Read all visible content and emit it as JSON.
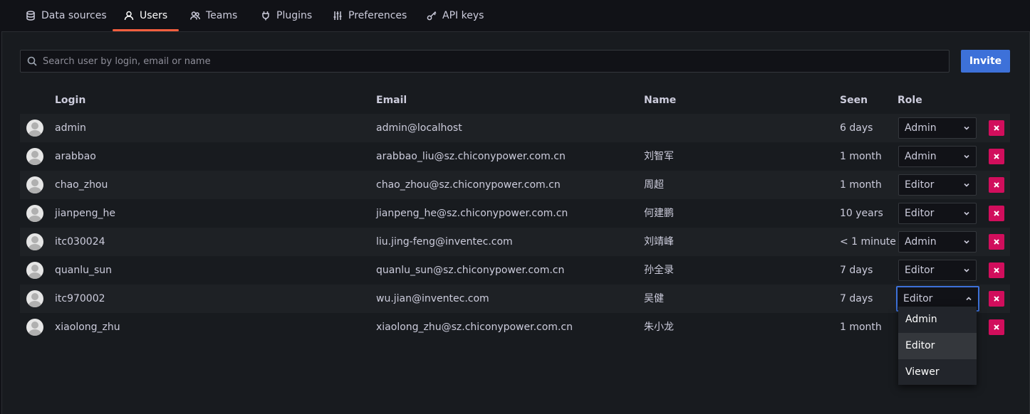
{
  "tabs": [
    {
      "label": "Data sources",
      "icon": "database-icon"
    },
    {
      "label": "Users",
      "icon": "user-icon",
      "active": true
    },
    {
      "label": "Teams",
      "icon": "users-icon"
    },
    {
      "label": "Plugins",
      "icon": "plug-icon"
    },
    {
      "label": "Preferences",
      "icon": "sliders-icon"
    },
    {
      "label": "API keys",
      "icon": "key-icon"
    }
  ],
  "search": {
    "placeholder": "Search user by login, email or name",
    "value": ""
  },
  "invite_label": "Invite",
  "columns": {
    "login": "Login",
    "email": "Email",
    "name": "Name",
    "seen": "Seen",
    "role": "Role"
  },
  "users": [
    {
      "login": "admin",
      "email": "admin@localhost",
      "name": "",
      "seen": "6 days",
      "role": "Admin"
    },
    {
      "login": "arabbao",
      "email": "arabbao_liu@sz.chiconypower.com.cn",
      "name": "刘智军",
      "seen": "1 month",
      "role": "Admin"
    },
    {
      "login": "chao_zhou",
      "email": "chao_zhou@sz.chiconypower.com.cn",
      "name": "周超",
      "seen": "1 month",
      "role": "Editor"
    },
    {
      "login": "jianpeng_he",
      "email": "jianpeng_he@sz.chiconypower.com.cn",
      "name": "何建鹏",
      "seen": "10 years",
      "role": "Editor"
    },
    {
      "login": "itc030024",
      "email": "liu.jing-feng@inventec.com",
      "name": "刘靖峰",
      "seen": "< 1 minute",
      "role": "Admin"
    },
    {
      "login": "quanlu_sun",
      "email": "quanlu_sun@sz.chiconypower.com.cn",
      "name": "孙全录",
      "seen": "7 days",
      "role": "Editor"
    },
    {
      "login": "itc970002",
      "email": "wu.jian@inventec.com",
      "name": "吴健",
      "seen": "7 days",
      "role": "Editor"
    },
    {
      "login": "xiaolong_zhu",
      "email": "xiaolong_zhu@sz.chiconypower.com.cn",
      "name": "朱小龙",
      "seen": "1 month",
      "role": ""
    }
  ],
  "role_options": [
    "Admin",
    "Editor",
    "Viewer"
  ],
  "selected_role_option": "Editor",
  "colors": {
    "accent": "#3d71d9",
    "active_tab": "#f55f3e",
    "delete": "#d10e5c",
    "background": "#111217",
    "panel": "#181b1f"
  }
}
